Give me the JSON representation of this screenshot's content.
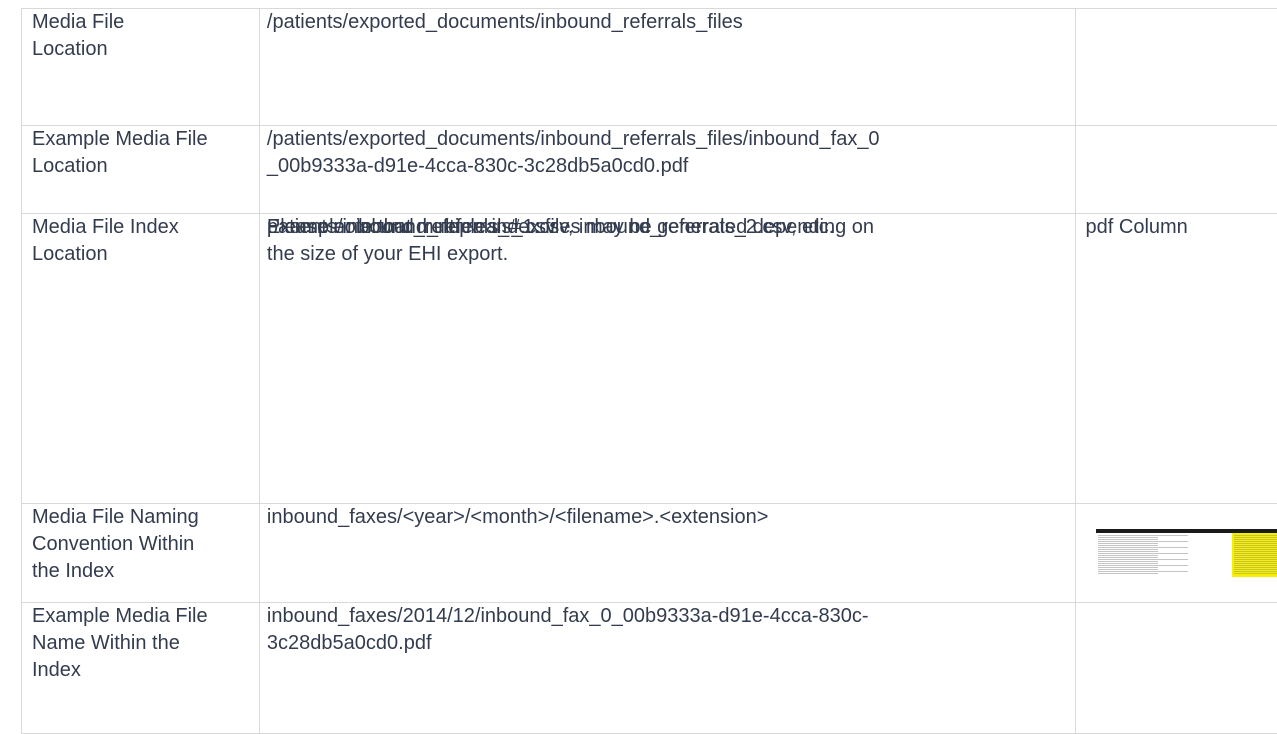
{
  "rows": [
    {
      "label": [
        "Media File",
        "Location"
      ],
      "value": [
        "/patients/exported_documents/inbound_referrals_files"
      ],
      "third": ""
    },
    {
      "label": [
        "Example Media File",
        "Location"
      ],
      "value": [
        "/patients/exported_documents/inbound_referrals_files/inbound_fax_0",
        "_00b9333a-d91e-4cca-830c-3c28db5a0cd0.pdf"
      ],
      "third": ""
    },
    {
      "label": [
        "Media File Index",
        "Location"
      ],
      "paragraphs": [
        [
          "patients/inbound_referrals_#.csv"
        ],
        [
          "Please note that multiple index files may be generated depending on",
          "the size of your EHI export."
        ],
        [
          "Example: inbound_referrals_1.csv, inbound_referrals_2.csv, etc."
        ]
      ],
      "third": "pdf Column"
    },
    {
      "label": [
        "Media File Naming",
        "Convention Within",
        "the Index"
      ],
      "value": [
        "inbound_faxes/<year>/<month>/<filename>.<extension>"
      ],
      "third_image": "spreadsheet-thumbnail"
    },
    {
      "label": [
        "Example Media File",
        "Name Within the",
        "Index"
      ],
      "value": [
        "inbound_faxes/2014/12/inbound_fax_0_00b9333a-d91e-4cca-830c-",
        "3c28db5a0cd0.pdf"
      ],
      "third": ""
    }
  ]
}
